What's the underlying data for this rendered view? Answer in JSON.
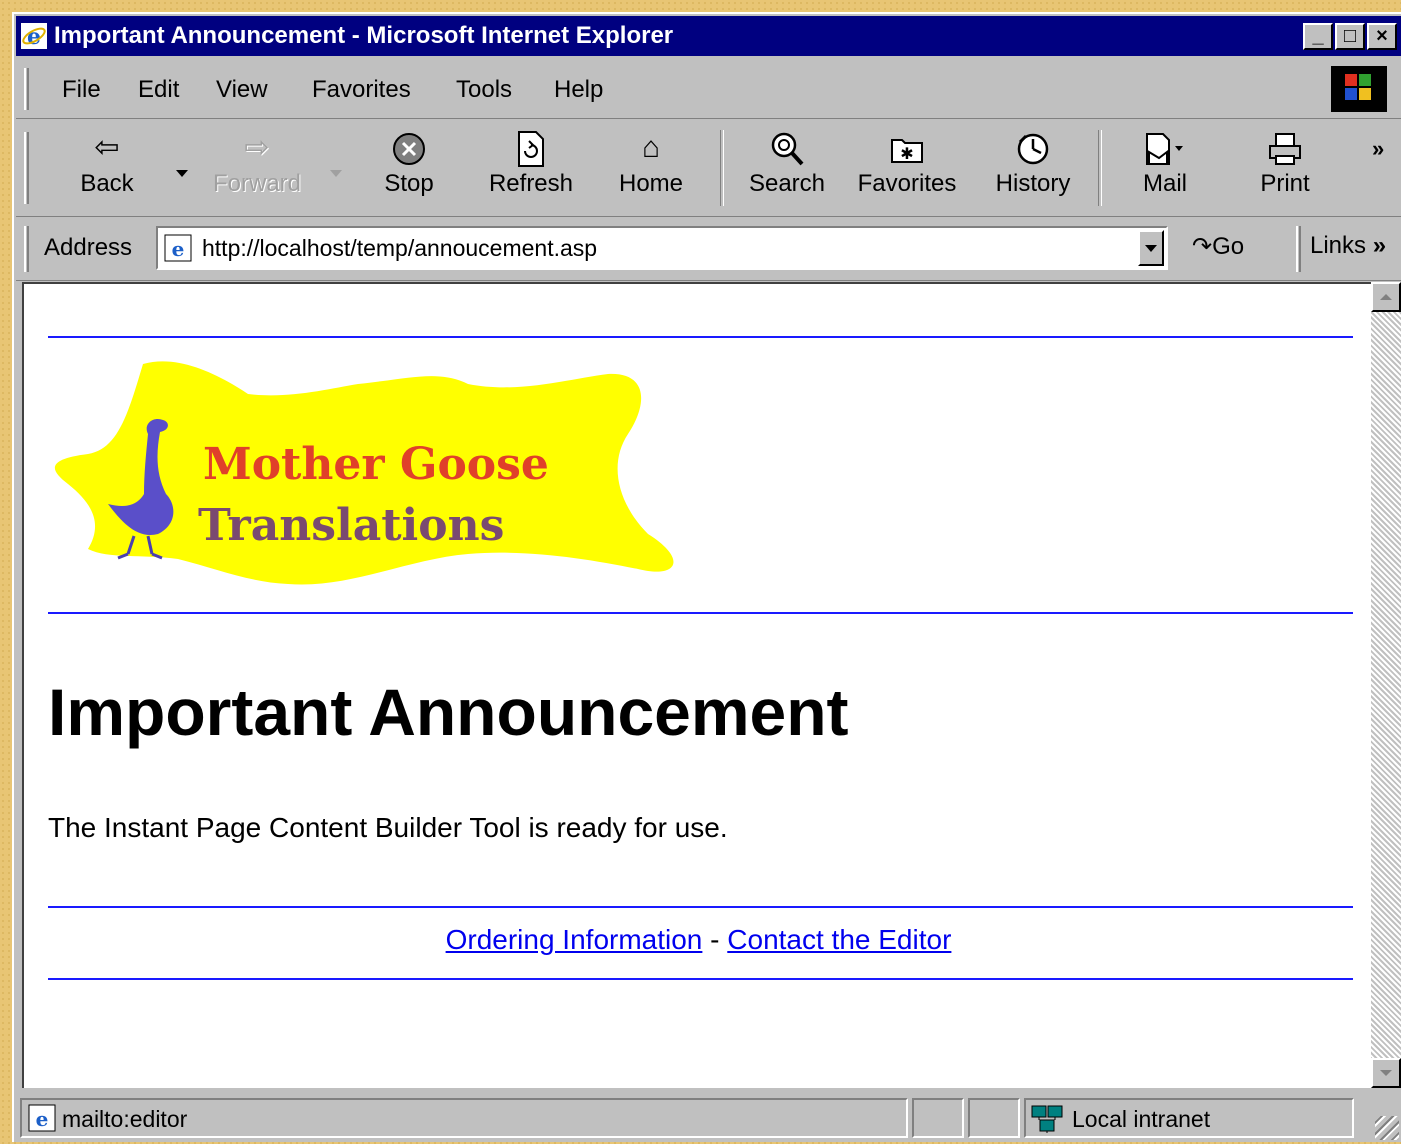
{
  "window": {
    "title": "Important Announcement - Microsoft Internet Explorer"
  },
  "menu": [
    "File",
    "Edit",
    "View",
    "Favorites",
    "Tools",
    "Help"
  ],
  "toolbar": {
    "back": "Back",
    "forward": "Forward",
    "stop": "Stop",
    "refresh": "Refresh",
    "home": "Home",
    "search": "Search",
    "favorites": "Favorites",
    "history": "History",
    "mail": "Mail",
    "print": "Print"
  },
  "address": {
    "label": "Address",
    "url": "http://localhost/temp/annoucement.asp",
    "go": "Go",
    "links": "Links"
  },
  "page": {
    "logo_line1": "Mother Goose",
    "logo_line2": "Translations",
    "heading": "Important Announcement",
    "paragraph": "The Instant Page Content Builder Tool is ready for use.",
    "link1": "Ordering Information",
    "separator": "-",
    "link2": "Contact the Editor"
  },
  "status": {
    "text": "mailto:editor",
    "zone": "Local intranet"
  },
  "colors": {
    "title_bar": "#000080",
    "chrome": "#c0c0c0",
    "rule": "#1a1aff",
    "link": "#0000ee",
    "logo_blob": "#ffff00"
  }
}
